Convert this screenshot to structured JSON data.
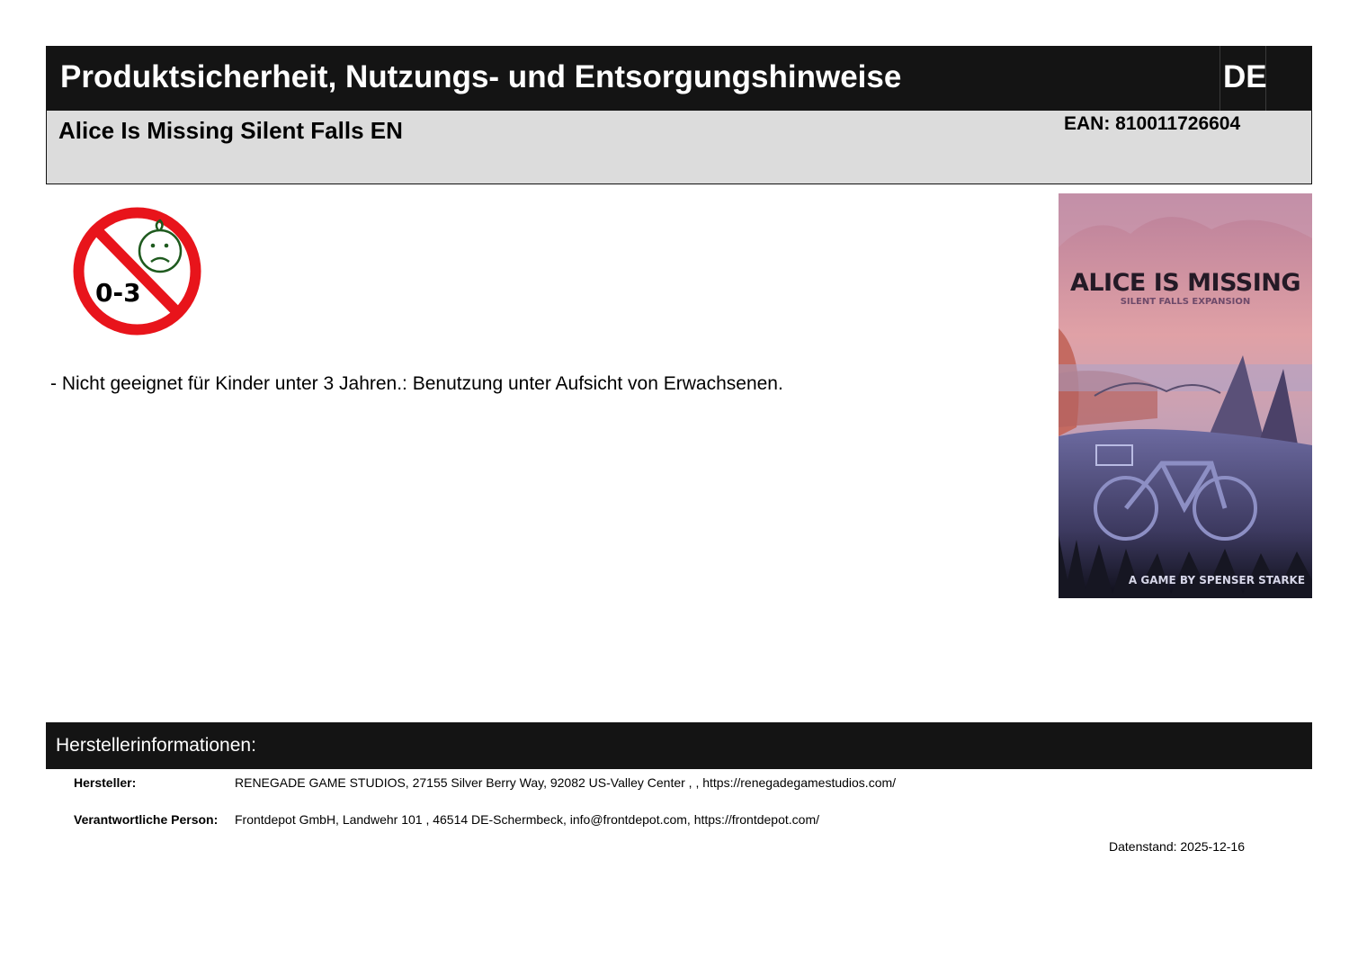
{
  "header": {
    "title": "Produktsicherheit, Nutzungs- und Entsorgungshinweise",
    "language": "DE"
  },
  "product": {
    "name": "Alice Is Missing Silent Falls EN",
    "ean": "EAN: 810011726604"
  },
  "age_warning_icon": {
    "icon": "no-children-under-3-icon",
    "label": "0-3",
    "colors": {
      "ring": "#e8141b",
      "face": "#1e5a1e"
    }
  },
  "warning_text": "- Nicht geeignet für Kinder unter 3 Jahren.: Benutzung unter Aufsicht von Erwachsenen.",
  "cover_image": {
    "title": "ALICE IS MISSING",
    "subtitle": "SILENT FALLS EXPANSION",
    "byline": "A GAME BY SPENSER STARKE"
  },
  "manufacturer_section": {
    "heading": "Herstellerinformationen:",
    "rows": [
      {
        "label": "Hersteller:",
        "value": "RENEGADE GAME STUDIOS, 27155 Silver Berry Way, 92082 US-Valley Center , , https://renegadegamestudios.com/"
      },
      {
        "label": "Verantwortliche Person:",
        "value": "Frontdepot GmbH, Landwehr 101 , 46514 DE-Schermbeck, info@frontdepot.com, https://frontdepot.com/"
      }
    ]
  },
  "footer": {
    "date": "Datenstand: 2025-12-16"
  }
}
